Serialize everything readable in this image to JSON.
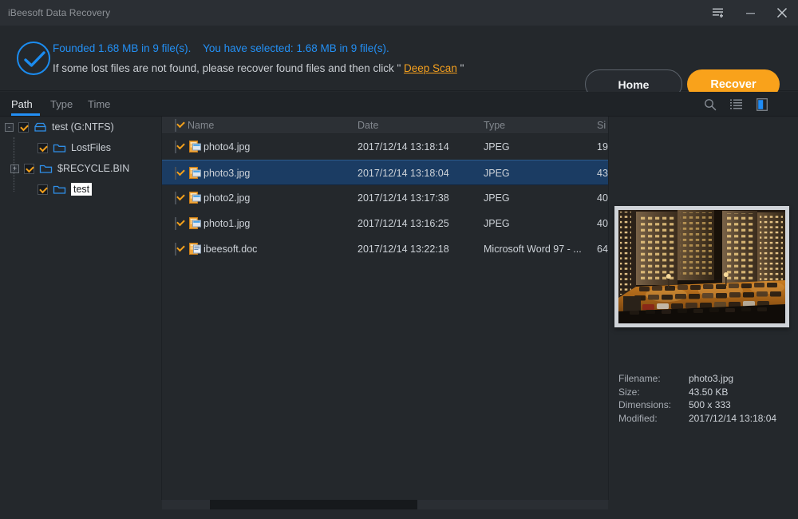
{
  "window": {
    "title": "iBeesoft Data Recovery",
    "controls": [
      {
        "name": "menu",
        "glyph": "menu-icon"
      },
      {
        "name": "minimize",
        "glyph": "minimize-icon"
      },
      {
        "name": "close",
        "glyph": "close-icon"
      }
    ]
  },
  "banner": {
    "line1": "Founded 1.68 MB in 9 file(s).    You have selected: 1.68 MB in 9 file(s).",
    "line2_before": "If some lost files are not found, please recover found files and then click \" ",
    "link": "Deep Scan",
    "line2_after": " \"",
    "home_label": "Home",
    "recover_label": "Recover",
    "accent_blue": "#2390f5",
    "accent_orange": "#f9a21b"
  },
  "tabs": [
    {
      "label": "Path",
      "active": true
    },
    {
      "label": "Type",
      "active": false
    },
    {
      "label": "Time",
      "active": false
    }
  ],
  "toolbar_icons": [
    {
      "name": "search-icon",
      "active": false
    },
    {
      "name": "list-view-icon",
      "active": false
    },
    {
      "name": "preview-pane-icon",
      "active": true
    }
  ],
  "tree": {
    "items": [
      {
        "label": "test (G:NTFS)",
        "indent": 0,
        "expander": "-",
        "icon": "drive-icon",
        "checked": true,
        "selected": false
      },
      {
        "label": "LostFiles",
        "indent": 1,
        "expander": "",
        "icon": "folder-icon",
        "checked": true,
        "selected": false
      },
      {
        "label": "$RECYCLE.BIN",
        "indent": 1,
        "expander": "+",
        "icon": "folder-icon",
        "checked": true,
        "selected": false
      },
      {
        "label": "test",
        "indent": 1,
        "expander": "",
        "icon": "folder-icon",
        "checked": true,
        "selected": true
      }
    ]
  },
  "filelist": {
    "columns": [
      "Name",
      "Date",
      "Type",
      "Si"
    ],
    "rows": [
      {
        "name": "photo4.jpg",
        "date": "2017/12/14 13:18:14",
        "type": "JPEG",
        "size": "19",
        "checked": true,
        "selected": false,
        "icon": "image-file-icon"
      },
      {
        "name": "photo3.jpg",
        "date": "2017/12/14 13:18:04",
        "type": "JPEG",
        "size": "43",
        "checked": true,
        "selected": true,
        "icon": "image-file-icon"
      },
      {
        "name": "photo2.jpg",
        "date": "2017/12/14 13:17:38",
        "type": "JPEG",
        "size": "40",
        "checked": true,
        "selected": false,
        "icon": "image-file-icon"
      },
      {
        "name": "photo1.jpg",
        "date": "2017/12/14 13:16:25",
        "type": "JPEG",
        "size": "40",
        "checked": true,
        "selected": false,
        "icon": "image-file-icon"
      },
      {
        "name": "ibeesoft.doc",
        "date": "2017/12/14 13:22:18",
        "type": "Microsoft Word 97 - ...",
        "size": "64",
        "checked": true,
        "selected": false,
        "icon": "doc-file-icon"
      }
    ]
  },
  "preview": {
    "image_alt": "night-photo-apartment-buildings-parking-lot",
    "meta": [
      {
        "key": "Filename:",
        "value": "photo3.jpg"
      },
      {
        "key": "Size:",
        "value": "43.50 KB"
      },
      {
        "key": "Dimensions:",
        "value": "500 x 333"
      },
      {
        "key": "Modified:",
        "value": "2017/12/14 13:18:04"
      }
    ]
  }
}
